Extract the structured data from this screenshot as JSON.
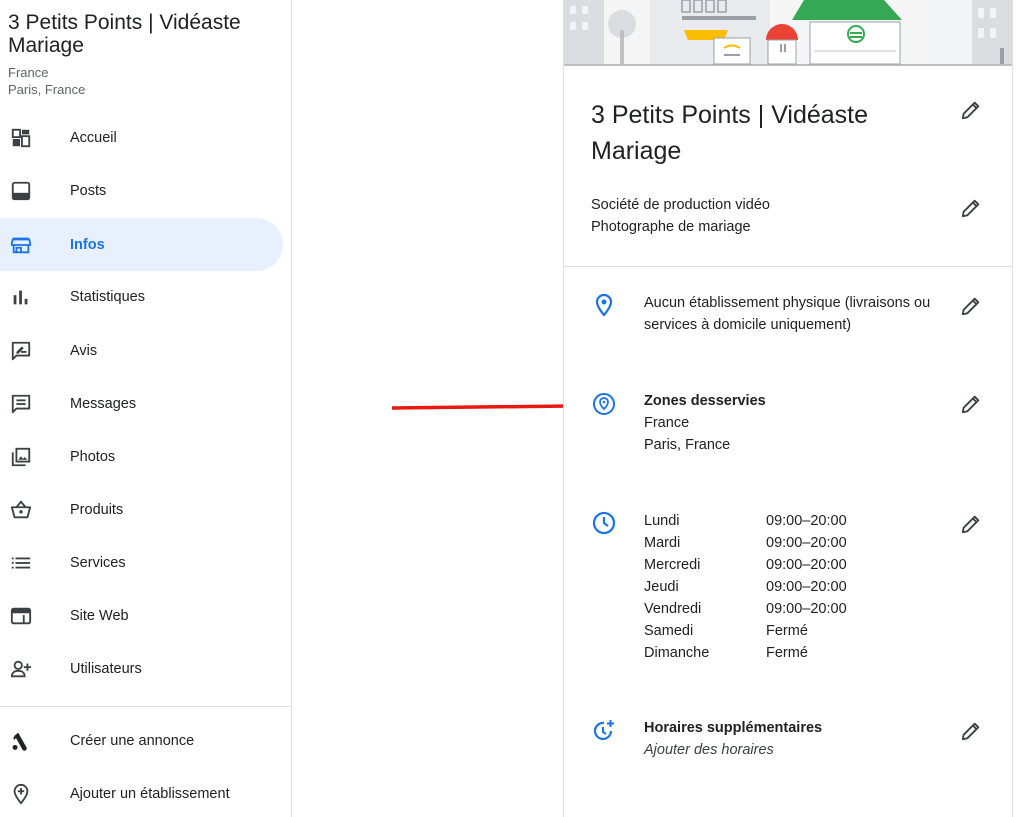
{
  "sidebar": {
    "business_name": "3 Petits Points | Vidéaste Mariage",
    "location_country": "France",
    "location_city": "Paris, France",
    "items": [
      {
        "label": "Accueil",
        "icon": "dashboard-icon"
      },
      {
        "label": "Posts",
        "icon": "posts-icon"
      },
      {
        "label": "Infos",
        "icon": "storefront-icon",
        "active": true
      },
      {
        "label": "Statistiques",
        "icon": "bar-chart-icon"
      },
      {
        "label": "Avis",
        "icon": "rate-review-icon"
      },
      {
        "label": "Messages",
        "icon": "message-icon"
      },
      {
        "label": "Photos",
        "icon": "photo-library-icon"
      },
      {
        "label": "Produits",
        "icon": "basket-icon"
      },
      {
        "label": "Services",
        "icon": "list-icon"
      },
      {
        "label": "Site Web",
        "icon": "web-icon"
      },
      {
        "label": "Utilisateurs",
        "icon": "person-add-icon"
      }
    ],
    "footer_items": [
      {
        "label": "Créer une annonce",
        "icon": "google-ads-icon"
      },
      {
        "label": "Ajouter un établissement",
        "icon": "add-location-icon"
      }
    ]
  },
  "info": {
    "title": "3 Petits Points | Vidéaste Mariage",
    "categories": [
      "Société de production vidéo",
      "Photographe de mariage"
    ],
    "address": "Aucun établissement physique (livraisons ou services à domicile uniquement)",
    "service_area": {
      "heading": "Zones desservies",
      "areas": [
        "France",
        "Paris, France"
      ]
    },
    "hours": [
      {
        "day": "Lundi",
        "time": "09:00–20:00"
      },
      {
        "day": "Mardi",
        "time": "09:00–20:00"
      },
      {
        "day": "Mercredi",
        "time": "09:00–20:00"
      },
      {
        "day": "Jeudi",
        "time": "09:00–20:00"
      },
      {
        "day": "Vendredi",
        "time": "09:00–20:00"
      },
      {
        "day": "Samedi",
        "time": "Fermé"
      },
      {
        "day": "Dimanche",
        "time": "Fermé"
      }
    ],
    "extra_hours": {
      "heading": "Horaires supplémentaires",
      "action": "Ajouter des horaires"
    }
  },
  "colors": {
    "accent": "#1a73e8",
    "active_bg": "#e8f0fe",
    "arrow": "#e8190f",
    "text": "#202124"
  }
}
